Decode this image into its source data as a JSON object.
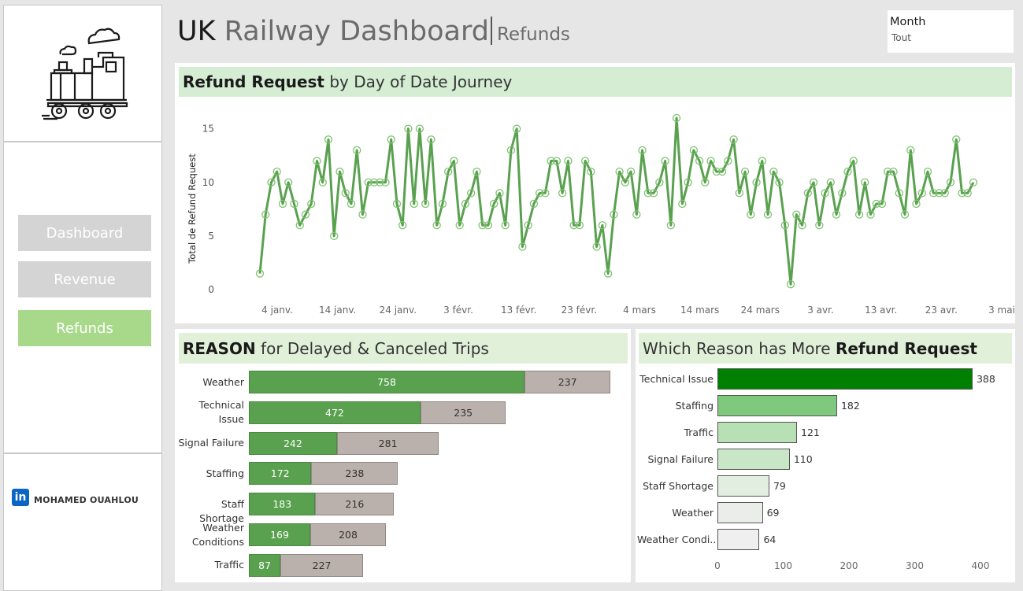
{
  "header": {
    "title_uk": "UK",
    "title_rest": "Railway Dashboard",
    "subtitle": "Refunds"
  },
  "filter": {
    "label": "Month",
    "value": "Tout"
  },
  "sidebar": {
    "logo_icon": "steam-train-icon",
    "nav": [
      {
        "label": "Dashboard",
        "active": false
      },
      {
        "label": "Revenue",
        "active": false
      },
      {
        "label": "Refunds",
        "active": true
      }
    ],
    "author": "MOHAMED OUAHLOU",
    "author_icon": "linkedin-icon",
    "colors": {
      "nav_inactive": "#d4d4d4",
      "nav_active": "#a8d98a",
      "linkedin": "#0a66c2"
    }
  },
  "line_section": {
    "title_bold": "Refund Request",
    "title_rest": " by Day of Date Journey"
  },
  "reason_section": {
    "title_bold": "REASON",
    "title_rest": " for Delayed & Canceled Trips"
  },
  "refund_section": {
    "title_rest": "Which Reason has More ",
    "title_bold": "Refund Request"
  },
  "chart_data": [
    {
      "type": "line",
      "ylabel": "Total de Refund Request",
      "ylim": [
        0,
        16
      ],
      "yticks": [
        0,
        5,
        10,
        15
      ],
      "xticks": [
        "4 janv.",
        "14 janv.",
        "24 janv.",
        "3 févr.",
        "13 févr.",
        "23 févr.",
        "4 mars",
        "14 mars",
        "24 mars",
        "3 avr.",
        "13 avr.",
        "23 avr.",
        "3 mai"
      ],
      "color": "#59a14f",
      "series": [
        {
          "values": [
            1.5,
            7,
            10,
            11,
            8,
            10,
            8,
            6,
            7,
            8,
            12,
            10,
            14,
            5,
            11,
            9,
            8,
            13,
            7,
            10,
            10,
            10,
            10,
            14,
            8,
            6,
            15,
            8,
            15,
            8,
            14,
            6,
            8,
            11,
            12,
            6,
            8,
            9,
            11,
            6,
            6,
            8,
            9,
            6,
            13,
            15,
            4,
            6,
            8,
            9,
            9,
            12,
            12,
            9,
            12,
            6,
            6,
            12,
            11,
            4,
            6,
            1.5,
            7,
            11,
            10,
            11,
            7,
            13,
            9,
            9,
            10,
            12,
            6,
            16,
            8,
            10,
            13,
            12,
            10,
            12,
            11,
            11,
            12,
            14,
            9,
            11,
            7,
            10,
            12,
            7,
            11,
            10,
            6,
            0.5,
            7,
            6,
            9,
            10,
            6,
            9,
            10,
            7,
            9,
            11,
            12,
            7,
            10,
            7,
            8,
            8,
            11,
            11,
            9,
            7,
            13,
            8,
            9,
            11,
            9,
            9,
            9,
            10,
            14,
            9,
            9,
            10
          ]
        }
      ]
    },
    {
      "type": "bar",
      "stacked": true,
      "orientation": "horizontal",
      "categories": [
        "Weather",
        "Technical Issue",
        "Signal Failure",
        "Staffing",
        "Staff Shortage",
        "Weather Conditions",
        "Traffic"
      ],
      "series": [
        {
          "values": [
            758,
            472,
            242,
            172,
            183,
            169,
            87
          ],
          "color": "#59a14f"
        },
        {
          "values": [
            237,
            235,
            281,
            238,
            216,
            208,
            227
          ],
          "color": "#bab0ac"
        }
      ]
    },
    {
      "type": "bar",
      "orientation": "horizontal",
      "categories": [
        "Technical Issue",
        "Staffing",
        "Traffic",
        "Signal Failure",
        "Staff Shortage",
        "Weather",
        "Weather Condi.."
      ],
      "values": [
        388,
        182,
        121,
        110,
        79,
        69,
        64
      ],
      "colors": [
        "#008000",
        "#7fc97f",
        "#b7e0b5",
        "#c9e7c7",
        "#e1eee0",
        "#e9efe8",
        "#efefef"
      ],
      "xticks": [
        0,
        100,
        200,
        300,
        400
      ],
      "xlim": [
        0,
        420
      ]
    }
  ]
}
